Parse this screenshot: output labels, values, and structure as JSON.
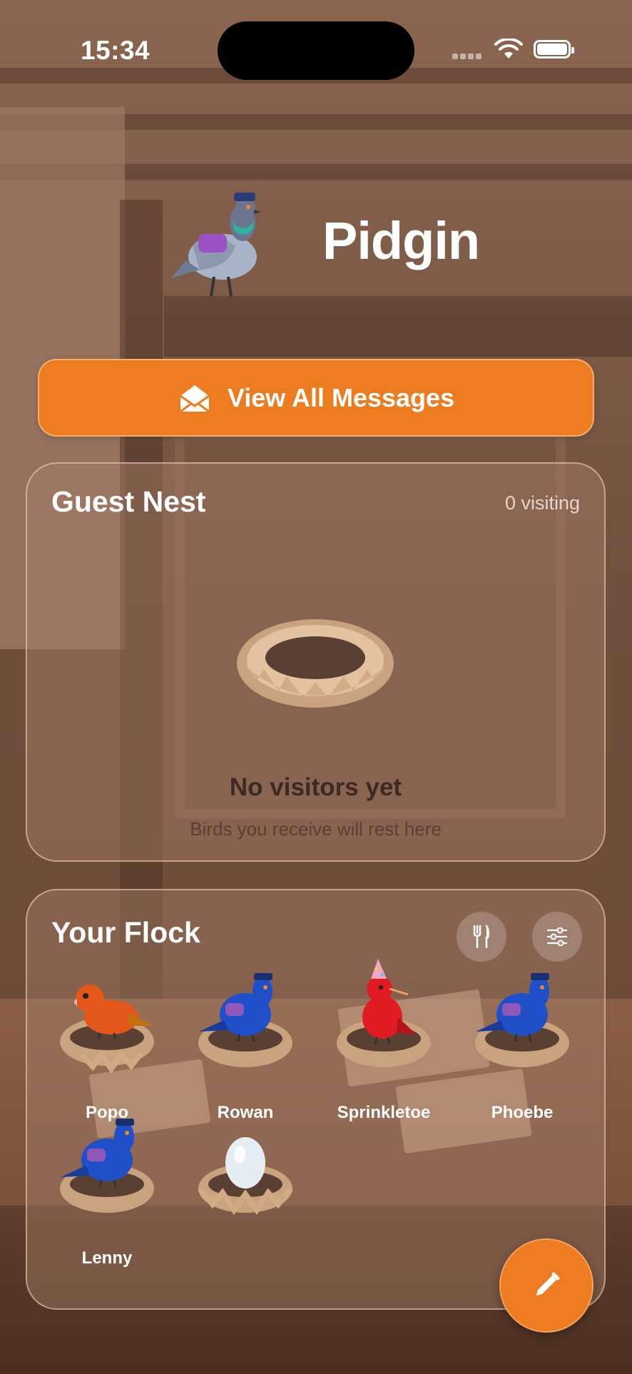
{
  "status_bar": {
    "time": "15:34"
  },
  "header": {
    "app_title": "Pidgin",
    "mascot_icon": "mail-pigeon-icon"
  },
  "actions": {
    "view_all_label": "View All Messages",
    "view_all_icon": "open-envelope-icon",
    "compose_icon": "pencil-icon"
  },
  "guest_nest": {
    "title": "Guest Nest",
    "visiting_count": "0 visiting",
    "empty_title": "No visitors yet",
    "empty_subtitle": "Birds you receive will rest here"
  },
  "flock": {
    "title": "Your Flock",
    "feed_icon": "fork-knife-icon",
    "filter_icon": "sliders-icon",
    "birds": [
      {
        "name": "Popo",
        "kind": "lovebird",
        "color": "#e4571a"
      },
      {
        "name": "Rowan",
        "kind": "pigeon",
        "color": "#1f4fc9"
      },
      {
        "name": "Sprinkletoe",
        "kind": "party-bird",
        "color": "#e01b24"
      },
      {
        "name": "Phoebe",
        "kind": "pigeon",
        "color": "#1f4fc9"
      },
      {
        "name": "Lenny",
        "kind": "pigeon",
        "color": "#1f4fc9"
      },
      {
        "name": "",
        "kind": "egg",
        "color": "#e6eef5"
      }
    ]
  },
  "colors": {
    "accent": "#ec7c1f",
    "text_on_accent": "#ffffff"
  }
}
